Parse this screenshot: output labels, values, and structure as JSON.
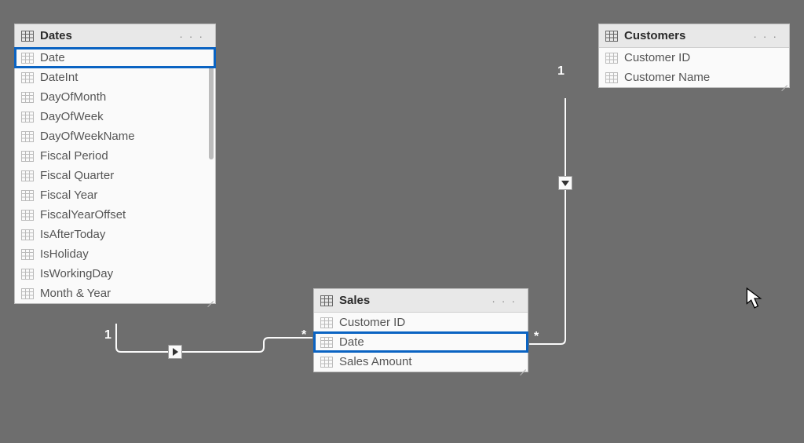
{
  "tables": {
    "dates": {
      "title": "Dates",
      "fields": [
        "Date",
        "DateInt",
        "DayOfMonth",
        "DayOfWeek",
        "DayOfWeekName",
        "Fiscal Period",
        "Fiscal Quarter",
        "Fiscal Year",
        "FiscalYearOffset",
        "IsAfterToday",
        "IsHoliday",
        "IsWorkingDay",
        "Month & Year"
      ],
      "selectedIndex": 0,
      "hasScrollbar": true
    },
    "sales": {
      "title": "Sales",
      "fields": [
        "Customer ID",
        "Date",
        "Sales Amount"
      ],
      "selectedIndex": 1,
      "hasScrollbar": false
    },
    "customers": {
      "title": "Customers",
      "fields": [
        "Customer ID",
        "Customer Name"
      ],
      "selectedIndex": -1,
      "hasScrollbar": false
    }
  },
  "relationships": [
    {
      "from": "dates",
      "to": "sales",
      "cardinalityFrom": "1",
      "cardinalityTo": "*",
      "direction": "right"
    },
    {
      "from": "customers",
      "to": "sales",
      "cardinalityFrom": "1",
      "cardinalityTo": "*",
      "direction": "down"
    }
  ],
  "ellipsis": "· · ·"
}
